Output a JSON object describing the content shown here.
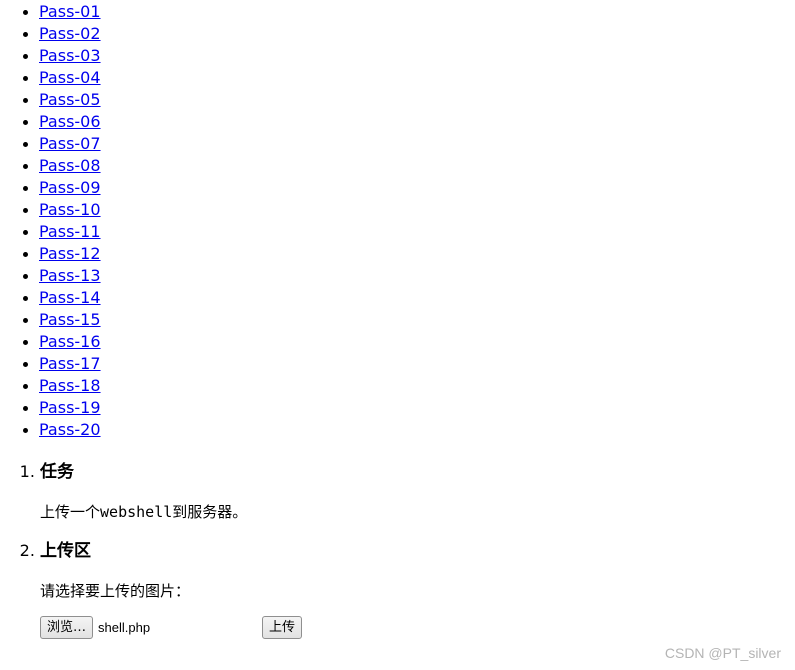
{
  "nav": {
    "items": [
      {
        "label": "Pass-01"
      },
      {
        "label": "Pass-02"
      },
      {
        "label": "Pass-03"
      },
      {
        "label": "Pass-04"
      },
      {
        "label": "Pass-05"
      },
      {
        "label": "Pass-06"
      },
      {
        "label": "Pass-07"
      },
      {
        "label": "Pass-08"
      },
      {
        "label": "Pass-09"
      },
      {
        "label": "Pass-10"
      },
      {
        "label": "Pass-11"
      },
      {
        "label": "Pass-12"
      },
      {
        "label": "Pass-13"
      },
      {
        "label": "Pass-14"
      },
      {
        "label": "Pass-15"
      },
      {
        "label": "Pass-16"
      },
      {
        "label": "Pass-17"
      },
      {
        "label": "Pass-18"
      },
      {
        "label": "Pass-19"
      },
      {
        "label": "Pass-20"
      }
    ]
  },
  "task": {
    "heading": "任务",
    "text_prefix": "上传一个",
    "text_code": "webshell",
    "text_suffix": "到服务器。"
  },
  "upload": {
    "heading": "上传区",
    "prompt": "请选择要上传的图片：",
    "browse_label": "浏览…",
    "file_name": "shell.php",
    "submit_label": "上传"
  },
  "watermark": "CSDN @PT_silver",
  "colors": {
    "link": "#0000ee",
    "watermark": "#b4b4b4"
  }
}
